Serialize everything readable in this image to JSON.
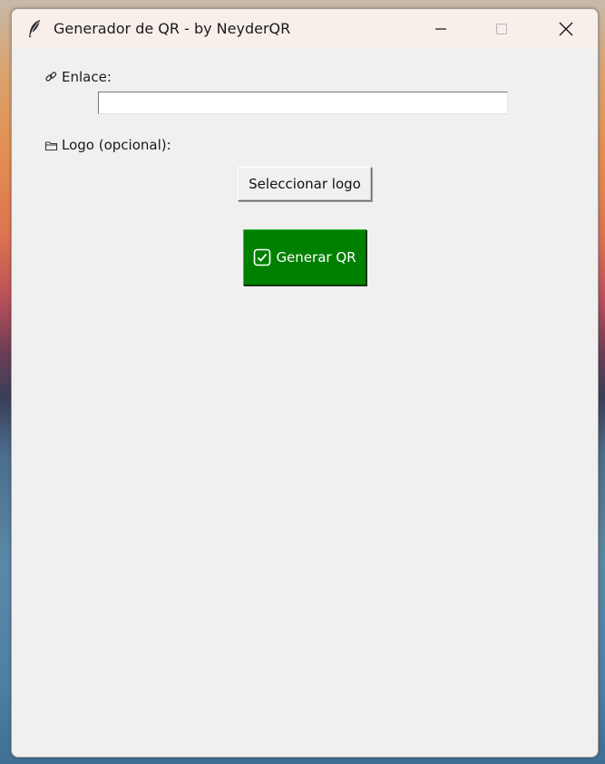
{
  "window": {
    "title": "Generador de QR - by NeyderQR",
    "app_icon": "feather-icon",
    "controls": {
      "minimize": "minimize-icon",
      "maximize": "maximize-icon",
      "close": "close-icon"
    }
  },
  "form": {
    "link_label": "Enlace:",
    "link_icon": "link-icon",
    "link_value": "",
    "logo_label": "Logo (opcional):",
    "logo_icon": "folder-icon",
    "select_logo_button": "Seleccionar logo",
    "generate_button": "Generar QR",
    "generate_icon": "checkbox-icon"
  },
  "colors": {
    "generate_button_bg": "#008000",
    "window_bg": "#f0f0f0",
    "titlebar_bg": "#f8efeb"
  }
}
